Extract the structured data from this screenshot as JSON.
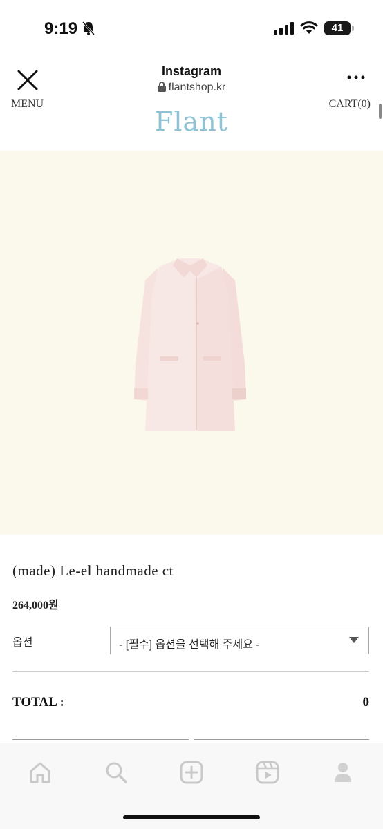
{
  "status_bar": {
    "time": "9:19",
    "battery": "41",
    "icons": [
      "bell-slash-icon",
      "signal-icon",
      "wifi-icon",
      "battery-icon"
    ]
  },
  "browser": {
    "title": "Instagram",
    "url": "flantshop.kr",
    "icons": [
      "close-icon",
      "lock-icon",
      "more-icon"
    ]
  },
  "site_header": {
    "menu": "MENU",
    "cart": "CART(0)",
    "logo": "Flant"
  },
  "product": {
    "name": "(made) Le-el handmade ct",
    "price": "264,000원",
    "option_label": "옵션",
    "option_selected": "- [필수] 옵션을 선택해 주세요 -",
    "total_label": "TOTAL :",
    "total_value": "0"
  },
  "bottom_nav": {
    "icons": [
      "home-icon",
      "search-icon",
      "add-post-icon",
      "reels-icon",
      "profile-icon"
    ]
  },
  "colors": {
    "image_background": "#fbf8ec",
    "logo": "#8ec3d6",
    "coat": "#f6e3e0"
  }
}
